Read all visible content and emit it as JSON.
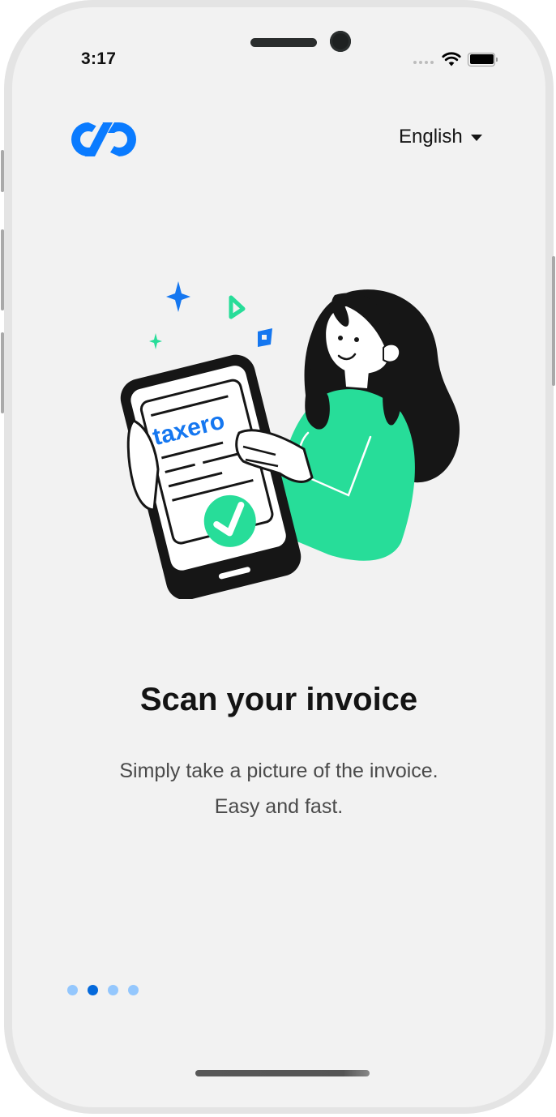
{
  "status_bar": {
    "time": "3:17",
    "icons": [
      "signal-dots-icon",
      "wifi-icon",
      "battery-icon"
    ]
  },
  "header": {
    "logo_icon": "taxeroo-infinity-logo",
    "language": {
      "selected": "English",
      "icon": "caret-down-icon"
    }
  },
  "illustration": {
    "description": "woman holding phone showing invoice with checkmark",
    "brand_text": "taxero",
    "icons": [
      "sparkle-icon",
      "play-icon",
      "square-icon",
      "check-circle-icon"
    ]
  },
  "onboarding": {
    "title": "Scan your invoice",
    "subtitle_line1": "Simply take a picture of the invoice.",
    "subtitle_line2": "Easy and fast."
  },
  "pagination": {
    "total": 4,
    "active_index": 1
  },
  "colors": {
    "brand_blue": "#0A7BFF",
    "accent_green": "#27DD99",
    "dot_active": "#0469DB",
    "dot_inactive": "#94C7FD",
    "background": "#F2F2F2",
    "text_primary": "#141414",
    "text_secondary": "#4A4A4A"
  }
}
